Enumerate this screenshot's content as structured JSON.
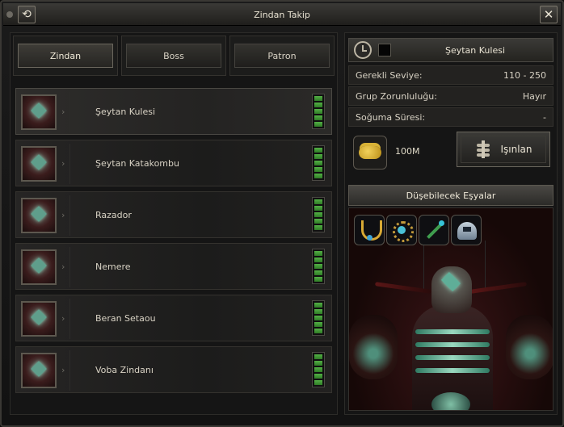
{
  "window": {
    "title": "Zindan Takip"
  },
  "tabs": [
    {
      "label": "Zindan",
      "active": true
    },
    {
      "label": "Boss",
      "active": false
    },
    {
      "label": "Patron",
      "active": false
    }
  ],
  "dungeons": [
    {
      "name": "Şeytan Kulesi",
      "selected": true
    },
    {
      "name": "Şeytan Katakombu",
      "selected": false
    },
    {
      "name": "Razador",
      "selected": false
    },
    {
      "name": "Nemere",
      "selected": false
    },
    {
      "name": "Beran Setaou",
      "selected": false
    },
    {
      "name": "Voba Zindanı",
      "selected": false
    }
  ],
  "details": {
    "title": "Şeytan Kulesi",
    "required_level_label": "Gerekli Seviye:",
    "required_level_value": "110 - 250",
    "group_label": "Grup Zorunluluğu:",
    "group_value": "Hayır",
    "cooldown_label": "Soğuma Süresi:",
    "cooldown_value": "-",
    "cost": "100M",
    "teleport_label": "Işınlan",
    "drops_label": "Düşebilecek Eşyalar",
    "drops": [
      {
        "icon": "necklace-icon"
      },
      {
        "icon": "orb-icon"
      },
      {
        "icon": "chain-icon"
      },
      {
        "icon": "helmet-icon"
      }
    ]
  },
  "colors": {
    "status_green": "#54b046",
    "text": "#d8d2c4",
    "panel": "#151515"
  }
}
